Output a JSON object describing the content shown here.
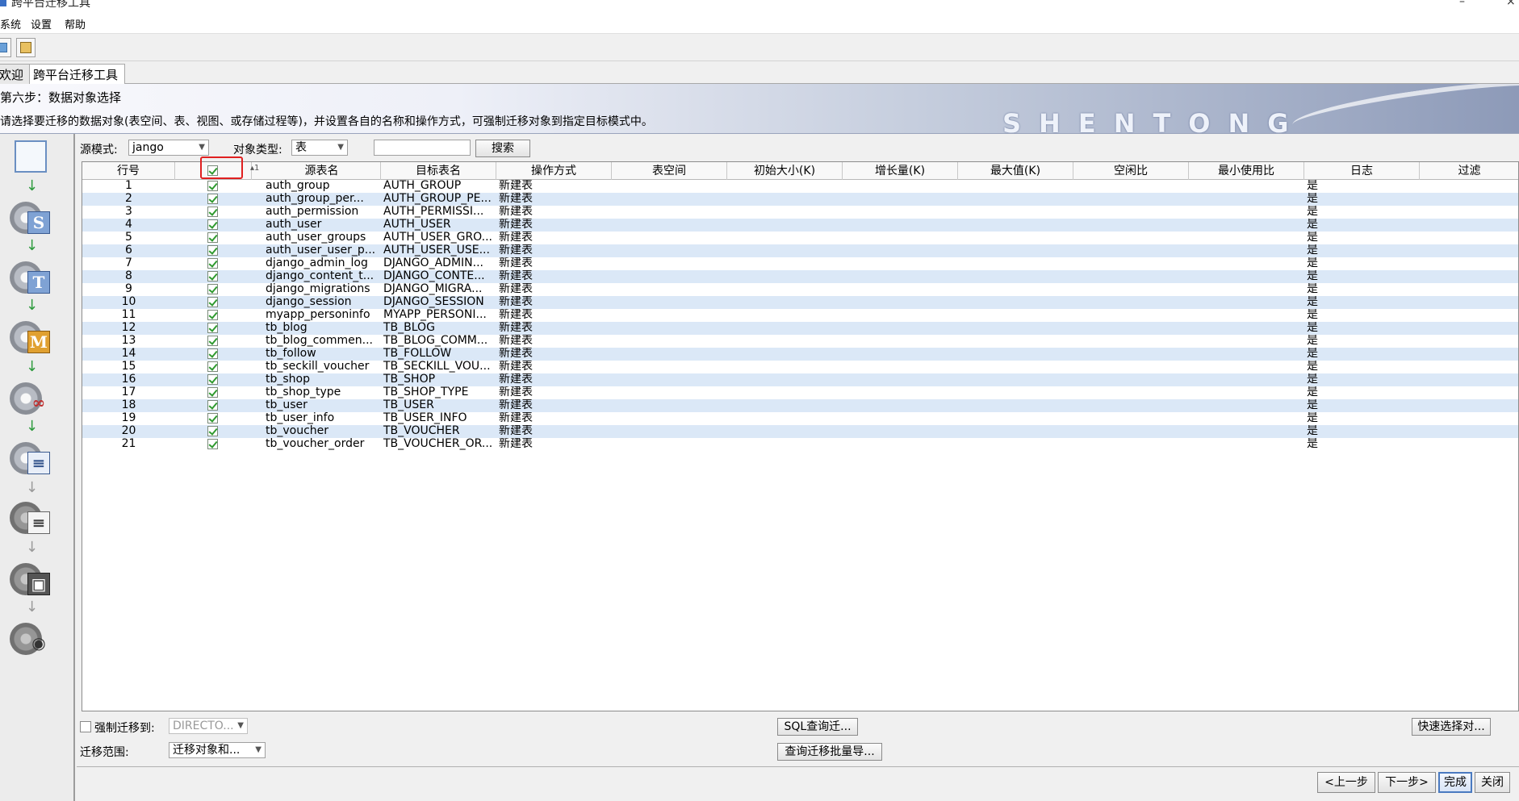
{
  "window": {
    "title": "跨平台迁移工具",
    "minimize": "–",
    "close": "×"
  },
  "menu": [
    "系统",
    "设置",
    "帮助"
  ],
  "tabs": [
    "欢迎",
    "跨平台迁移工具"
  ],
  "banner": {
    "step": "第六步：数据对象选择",
    "description": "请选择要迁移的数据对象(表空间、表、视图、或存储过程等)，并设置各自的名称和操作方式，可强制迁移对象到指定目标模式中。",
    "brand": "SHENTONG"
  },
  "filters": {
    "source_schema_label": "源模式:",
    "source_schema_value": "jango",
    "object_type_label": "对象类型:",
    "object_type_value": "表",
    "search_value": "",
    "search_button": "搜索"
  },
  "table": {
    "sort_indicator": "▴1",
    "headers": [
      "行号",
      "",
      "源表名",
      "目标表名",
      "操作方式",
      "表空间",
      "初始大小(K)",
      "增长量(K)",
      "最大值(K)",
      "空闲比",
      "最小使用比",
      "日志",
      "过滤"
    ],
    "rows": [
      {
        "n": "1",
        "src": "auth_group",
        "dst": "AUTH_GROUP",
        "op": "新建表",
        "log": "是"
      },
      {
        "n": "2",
        "src": "auth_group_per...",
        "dst": "AUTH_GROUP_PE...",
        "op": "新建表",
        "log": "是"
      },
      {
        "n": "3",
        "src": "auth_permission",
        "dst": "AUTH_PERMISSI...",
        "op": "新建表",
        "log": "是"
      },
      {
        "n": "4",
        "src": "auth_user",
        "dst": "AUTH_USER",
        "op": "新建表",
        "log": "是"
      },
      {
        "n": "5",
        "src": "auth_user_groups",
        "dst": "AUTH_USER_GRO...",
        "op": "新建表",
        "log": "是"
      },
      {
        "n": "6",
        "src": "auth_user_user_p...",
        "dst": "AUTH_USER_USE...",
        "op": "新建表",
        "log": "是"
      },
      {
        "n": "7",
        "src": "django_admin_log",
        "dst": "DJANGO_ADMIN...",
        "op": "新建表",
        "log": "是"
      },
      {
        "n": "8",
        "src": "django_content_t...",
        "dst": "DJANGO_CONTE...",
        "op": "新建表",
        "log": "是"
      },
      {
        "n": "9",
        "src": "django_migrations",
        "dst": "DJANGO_MIGRA...",
        "op": "新建表",
        "log": "是"
      },
      {
        "n": "10",
        "src": "django_session",
        "dst": "DJANGO_SESSION",
        "op": "新建表",
        "log": "是"
      },
      {
        "n": "11",
        "src": "myapp_personinfo",
        "dst": "MYAPP_PERSONI...",
        "op": "新建表",
        "log": "是"
      },
      {
        "n": "12",
        "src": "tb_blog",
        "dst": "TB_BLOG",
        "op": "新建表",
        "log": "是"
      },
      {
        "n": "13",
        "src": "tb_blog_commen...",
        "dst": "TB_BLOG_COMM...",
        "op": "新建表",
        "log": "是"
      },
      {
        "n": "14",
        "src": "tb_follow",
        "dst": "TB_FOLLOW",
        "op": "新建表",
        "log": "是"
      },
      {
        "n": "15",
        "src": "tb_seckill_voucher",
        "dst": "TB_SECKILL_VOU...",
        "op": "新建表",
        "log": "是"
      },
      {
        "n": "16",
        "src": "tb_shop",
        "dst": "TB_SHOP",
        "op": "新建表",
        "log": "是"
      },
      {
        "n": "17",
        "src": "tb_shop_type",
        "dst": "TB_SHOP_TYPE",
        "op": "新建表",
        "log": "是"
      },
      {
        "n": "18",
        "src": "tb_user",
        "dst": "TB_USER",
        "op": "新建表",
        "log": "是"
      },
      {
        "n": "19",
        "src": "tb_user_info",
        "dst": "TB_USER_INFO",
        "op": "新建表",
        "log": "是"
      },
      {
        "n": "20",
        "src": "tb_voucher",
        "dst": "TB_VOUCHER",
        "op": "新建表",
        "log": "是"
      },
      {
        "n": "21",
        "src": "tb_voucher_order",
        "dst": "TB_VOUCHER_OR...",
        "op": "新建表",
        "log": "是"
      }
    ]
  },
  "options": {
    "force_migrate_label": "强制迁移到:",
    "force_migrate_value": "DIRECTO...",
    "scope_label": "迁移范围:",
    "scope_value": "迁移对象和...",
    "sql_query_button": "SQL查询迁...",
    "batch_import_button": "查询迁移批量导...",
    "quick_select_button": "快速选择对..."
  },
  "nav": {
    "prev": "<上一步",
    "next": "下一步>",
    "finish": "完成",
    "close": "关闭"
  },
  "sidebar_steps": [
    "welcome",
    "S",
    "T",
    "M",
    "link",
    "list",
    "list",
    "box",
    "eye"
  ]
}
